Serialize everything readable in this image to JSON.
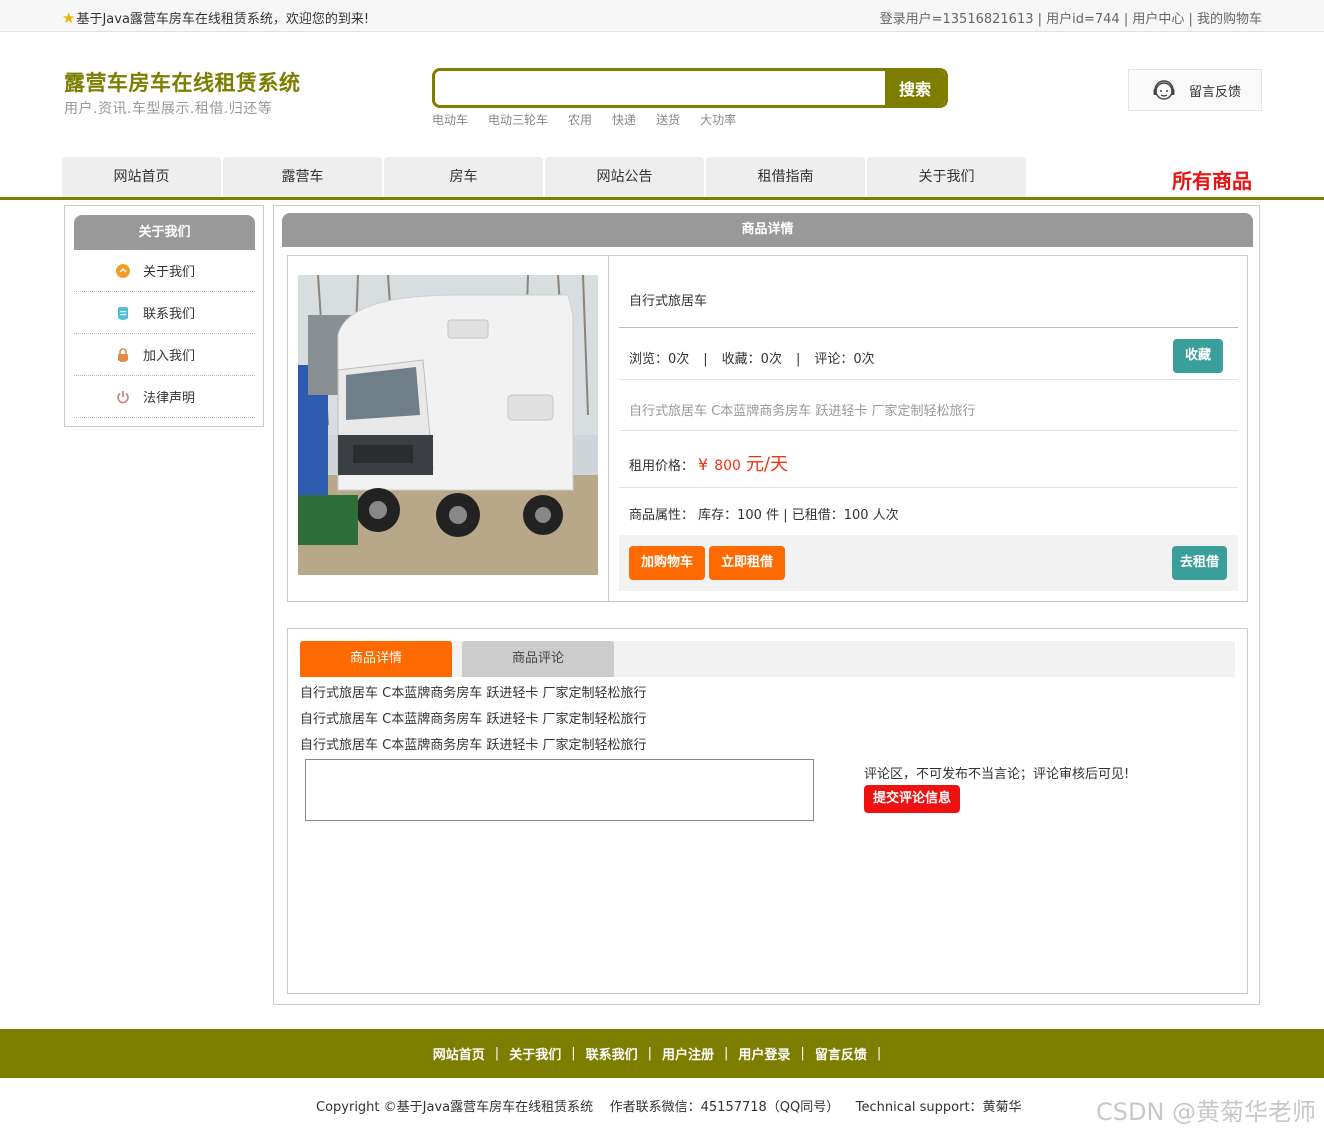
{
  "topbar": {
    "welcome": "基于Java露营车房车在线租赁系统，欢迎您的到来!",
    "user_links": "登录用户=13516821613 | 用户id=744 | 用户中心 | 我的购物车"
  },
  "header": {
    "title": "露营车房车在线租赁系统",
    "subtitle": "用户.资讯.车型展示.租借.归还等",
    "search_button": "搜索",
    "search_value": "",
    "hotwords": [
      "电动车",
      "电动三轮车",
      "农用",
      "快递",
      "送货",
      "大功率"
    ],
    "feedback": "留言反馈"
  },
  "nav": {
    "items": [
      "网站首页",
      "露营车",
      "房车",
      "网站公告",
      "租借指南",
      "关于我们"
    ],
    "all_goods": "所有商品"
  },
  "sidebar": {
    "title": "关于我们",
    "items": [
      {
        "label": "关于我们",
        "icon": "orange-circle-icon",
        "color": "#f59a23"
      },
      {
        "label": "联系我们",
        "icon": "clipboard-icon",
        "color": "#4fc1d6"
      },
      {
        "label": "加入我们",
        "icon": "lock-icon",
        "color": "#e08a4a"
      },
      {
        "label": "法律声明",
        "icon": "power-icon",
        "color": "#c97a7a"
      }
    ]
  },
  "main": {
    "title": "商品详情",
    "product": {
      "name": "自行式旅居车",
      "stats": [
        "浏览：0次",
        "收藏：0次",
        "评论：0次"
      ],
      "favorite_button": "收藏",
      "description": "自行式旅居车 C本蓝牌商务房车 跃进轻卡 厂家定制轻松旅行",
      "price_label": "租用价格：",
      "price_symbol": "¥",
      "price_value": "800",
      "price_unit": "元/天",
      "attr": "商品属性：  库存：100 件 | 已租借：100 人次",
      "add_cart": "加购物车",
      "rent_now": "立即租借",
      "go_rent": "去租借"
    },
    "tabs": {
      "active": "商品详情",
      "inactive": "商品评论",
      "lines": [
        "自行式旅居车 C本蓝牌商务房车 跃进轻卡 厂家定制轻松旅行",
        "自行式旅居车 C本蓝牌商务房车 跃进轻卡 厂家定制轻松旅行",
        "自行式旅居车 C本蓝牌商务房车 跃进轻卡 厂家定制轻松旅行"
      ],
      "comment_value": "",
      "comment_note": "评论区，不可发布不当言论；评论审核后可见!",
      "submit": "提交评论信息"
    }
  },
  "footer": {
    "links": [
      "网站首页",
      "关于我们",
      "联系我们",
      "用户注册",
      "用户登录",
      "留言反馈"
    ],
    "separator": "|",
    "copyright": "Copyright ©基于Java露营车房车在线租赁系统    作者联系微信：45157718（QQ同号）    Technical support：黄菊华",
    "watermark": "CSDN @黄菊华老师"
  },
  "colors": {
    "brand_olive": "#7d7d00",
    "orange": "#ff6a00",
    "teal": "#3a9e9a",
    "red": "#ee1111"
  }
}
